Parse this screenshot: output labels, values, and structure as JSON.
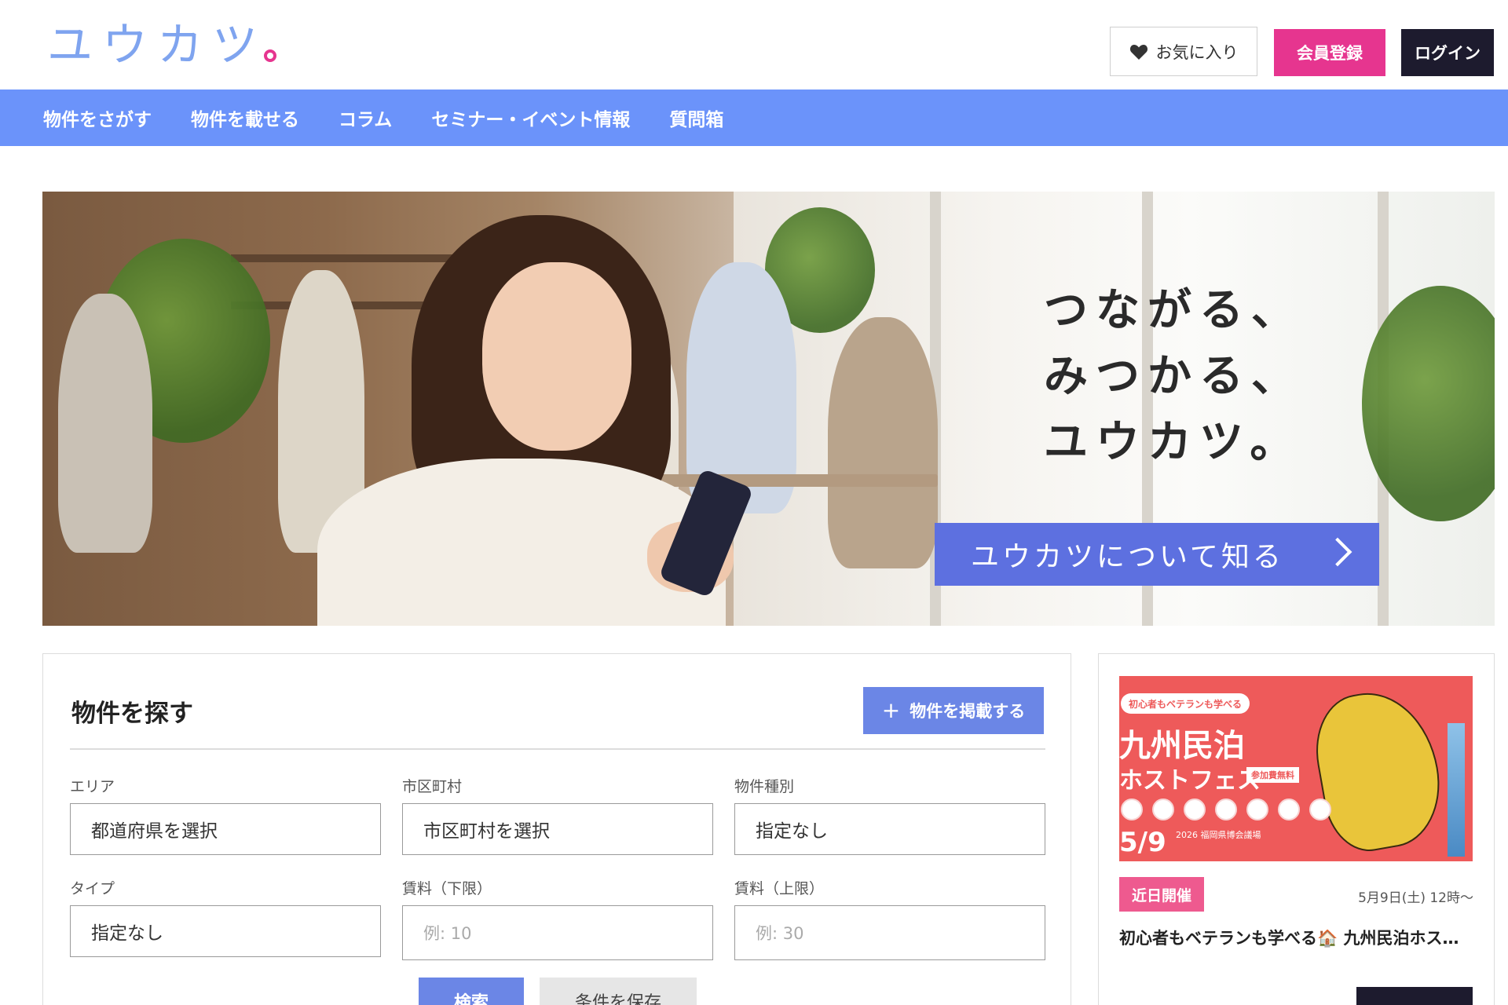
{
  "header": {
    "logo_text": "ユウカツ",
    "favorites_label": "お気に入り",
    "register_label": "会員登録",
    "login_label": "ログイン"
  },
  "nav": {
    "items": [
      {
        "label": "物件をさがす"
      },
      {
        "label": "物件を載せる"
      },
      {
        "label": "コラム"
      },
      {
        "label": "セミナー・イベント情報"
      },
      {
        "label": "質問箱"
      }
    ]
  },
  "hero": {
    "copy_line1": "つながる、",
    "copy_line2": "みつかる、",
    "copy_line3": "ユウカツ。",
    "cta_label": "ユウカツについて知る"
  },
  "search": {
    "title": "物件を探す",
    "post_button_label": "物件を掲載する",
    "fields": {
      "area": {
        "label": "エリア",
        "value": "都道府県を選択"
      },
      "city": {
        "label": "市区町村",
        "value": "市区町村を選択"
      },
      "property_type": {
        "label": "物件種別",
        "value": "指定なし"
      },
      "type": {
        "label": "タイプ",
        "value": "指定なし"
      },
      "rent_min": {
        "label": "賃料（下限）",
        "placeholder": "例: 10"
      },
      "rent_max": {
        "label": "賃料（上限）",
        "placeholder": "例: 30"
      }
    },
    "search_button_label": "検索",
    "save_button_label": "条件を保存"
  },
  "event": {
    "banner": {
      "tag": "初心者もベテランも学べる",
      "title1": "九州民泊",
      "title2": "ホストフェス",
      "badge": "参加費無料",
      "date": "5/9",
      "date_sub": "2026 福岡県博会議場"
    },
    "status_badge": "近日開催",
    "date": "5月9日(土) 12時〜",
    "title": "初心者もベテランも学べる🏠 九州民泊ホストフェス"
  },
  "colors": {
    "nav_bg": "#6b93fa",
    "register_bg": "#e6358f",
    "login_bg": "#1d1b2e",
    "cta_bg": "#5d70e0",
    "primary_button": "#6b86e6",
    "event_badge": "#ee5a8f",
    "logo_color": "#7fa4ef"
  }
}
